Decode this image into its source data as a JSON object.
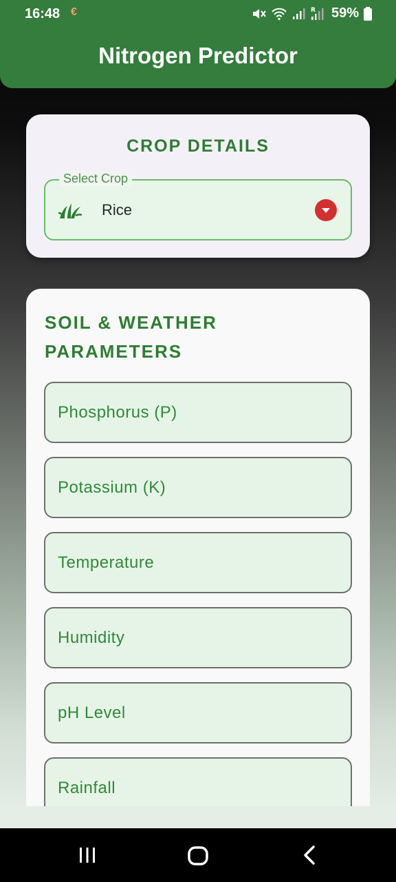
{
  "status_bar": {
    "time": "16:48",
    "notification_glyph": "€",
    "battery_percent": "59%",
    "icons": [
      "mute-icon",
      "wifi-icon",
      "signal-icon",
      "signal-roaming-icon",
      "battery-icon"
    ]
  },
  "app_bar": {
    "title": "Nitrogen Predictor"
  },
  "crop_card": {
    "heading": "CROP DETAILS",
    "select_label": "Select Crop",
    "selected_value": "Rice",
    "icon": "grass-icon",
    "dropdown_icon": "dropdown-arrow-icon"
  },
  "params_card": {
    "heading": "SOIL & WEATHER PARAMETERS",
    "fields": [
      {
        "placeholder": "Phosphorus (P)"
      },
      {
        "placeholder": "Potassium (K)"
      },
      {
        "placeholder": "Temperature"
      },
      {
        "placeholder": "Humidity"
      },
      {
        "placeholder": "pH Level"
      },
      {
        "placeholder": "Rainfall"
      }
    ]
  },
  "nav_bar": {
    "buttons": [
      "recents-icon",
      "home-icon",
      "back-icon"
    ]
  },
  "colors": {
    "primary": "#347d3c",
    "accent_red": "#d32f2f",
    "field_bg": "#e6f4e7"
  }
}
